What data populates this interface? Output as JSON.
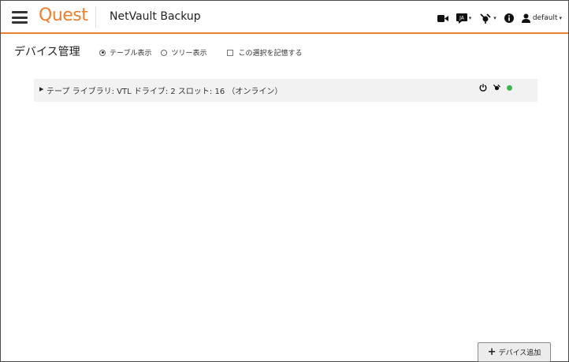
{
  "header": {
    "logo": "Quest",
    "product": "NetVault Backup",
    "user_label": "default",
    "icons": [
      "hamburger-menu-icon",
      "video-icon",
      "language-icon",
      "plugin-icon",
      "info-icon",
      "user-icon"
    ]
  },
  "page": {
    "title": "デバイス管理",
    "view_options": {
      "table_view": "テーブル表示",
      "tree_view": "ツリー表示",
      "remember": "この選択を記憶する",
      "selected": "table_view"
    }
  },
  "devices": [
    {
      "label": "テープ ライブラリ: VTL ドライブ: 2 スロット: 16 （オンライン）",
      "status": "online",
      "status_color": "#3fb44a",
      "action_icons": [
        "power-icon",
        "plugin-icon",
        "status-dot"
      ]
    }
  ],
  "add_button": {
    "label": "デバイス追加"
  },
  "colors": {
    "accent": "#f07f2d",
    "online": "#3fb44a"
  }
}
